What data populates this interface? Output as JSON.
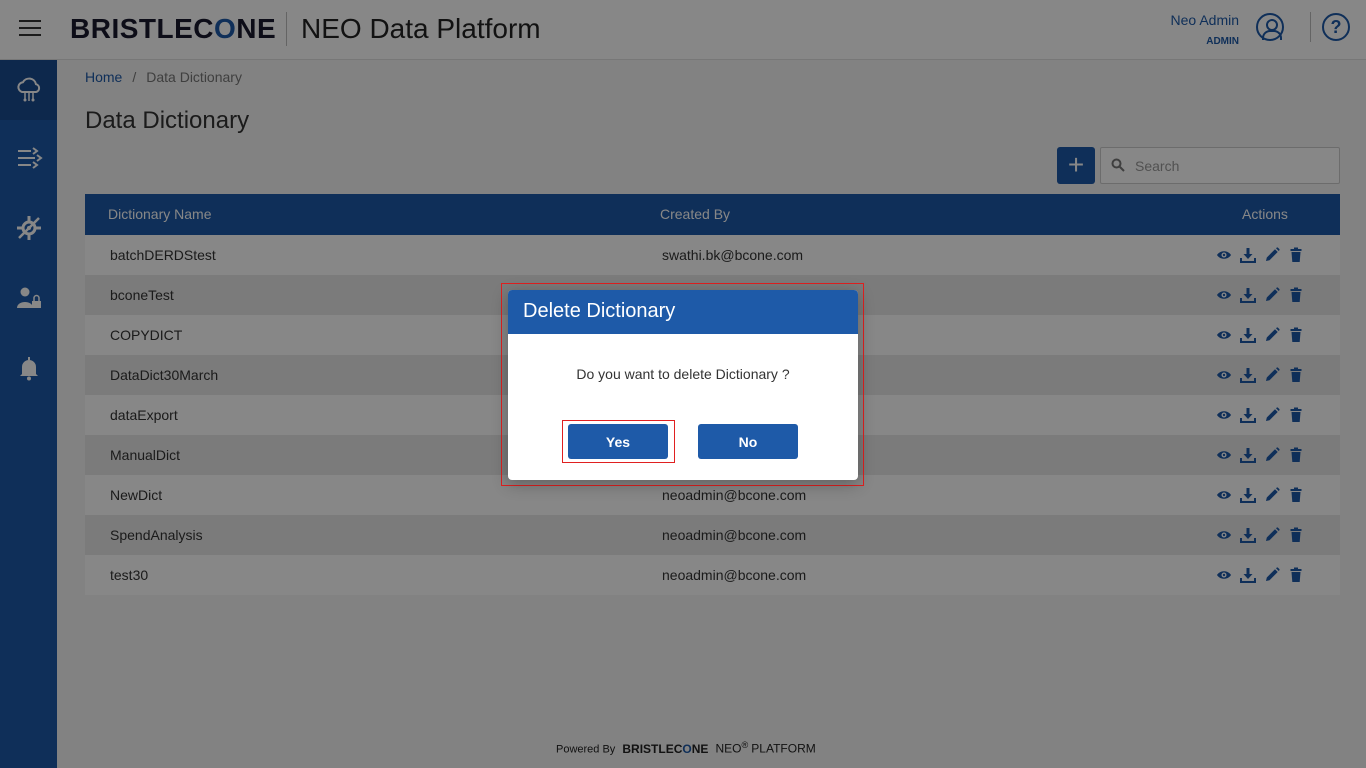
{
  "header": {
    "logo_prefix": "BRISTLEC",
    "logo_c": "O",
    "logo_suffix": "NE",
    "app_title": "NEO Data Platform",
    "user_name": "Neo Admin",
    "user_role": "ADMIN",
    "help_glyph": "?"
  },
  "sidebar": {
    "items": [
      {
        "icon": "cloud-data-icon",
        "active": true
      },
      {
        "icon": "pipeline-icon"
      },
      {
        "icon": "settings-tools-icon"
      },
      {
        "icon": "user-lock-icon"
      },
      {
        "icon": "bell-icon"
      }
    ]
  },
  "breadcrumb": {
    "home": "Home",
    "separator": "/",
    "current": "Data Dictionary"
  },
  "page_title": "Data Dictionary",
  "toolbar": {
    "add_label": "+",
    "search_placeholder": "Search"
  },
  "table": {
    "columns": [
      "Dictionary Name",
      "Created By",
      "Actions"
    ],
    "rows": [
      {
        "name": "batchDERDStest",
        "created_by": "swathi.bk@bcone.com"
      },
      {
        "name": "bconeTest",
        "created_by": ""
      },
      {
        "name": "COPYDICT",
        "created_by": ""
      },
      {
        "name": "DataDict30March",
        "created_by": ""
      },
      {
        "name": "dataExport",
        "created_by": ""
      },
      {
        "name": "ManualDict",
        "created_by": ""
      },
      {
        "name": "NewDict",
        "created_by": "neoadmin@bcone.com"
      },
      {
        "name": "SpendAnalysis",
        "created_by": "neoadmin@bcone.com"
      },
      {
        "name": "test30",
        "created_by": "neoadmin@bcone.com"
      }
    ]
  },
  "footer": {
    "powered_by": "Powered By",
    "brand_prefix": "BRISTLEC",
    "brand_c": "O",
    "brand_suffix": "NE",
    "neo": "NEO",
    "reg": "®",
    "platform": "PLATFORM"
  },
  "dialog": {
    "title": "Delete Dictionary",
    "message": "Do you want to delete Dictionary ?",
    "yes_label": "Yes",
    "no_label": "No"
  },
  "colors": {
    "primary": "#1e5aa8",
    "highlight": "#e02020"
  }
}
